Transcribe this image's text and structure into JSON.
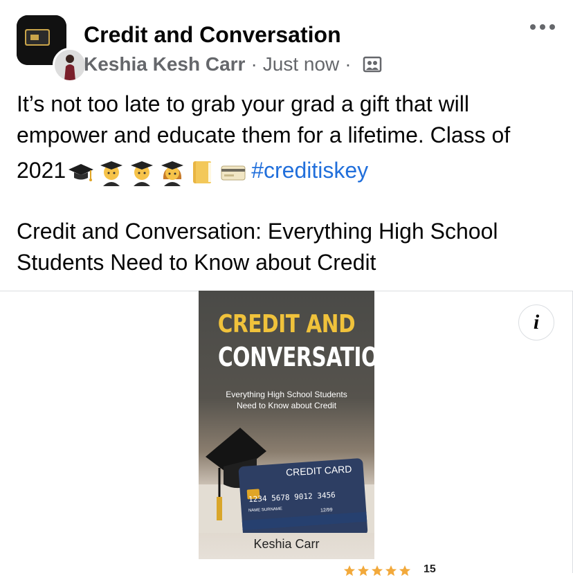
{
  "header": {
    "group_name": "Credit and Conversation",
    "author": "Keshia Kesh Carr",
    "separator": "·",
    "timestamp": "Just now",
    "privacy_icon": "group-privacy-icon",
    "more_icon": "more-options-icon"
  },
  "post": {
    "line1": "It’s not too late to grab your grad a gift that will",
    "line2": "empower and educate them for a lifetime. Class of",
    "line3_prefix": "2021",
    "emojis": [
      "graduation-cap-icon",
      "man-student-icon",
      "man-student-icon",
      "woman-student-icon",
      "ledger-icon",
      "credit-card-icon"
    ],
    "hashtag": "#creditiskey",
    "link_line1": "Credit and Conversation: Everything High School",
    "link_line2": "Students Need to Know about Credit"
  },
  "card": {
    "info_label": "i",
    "book": {
      "title_line1": "CREDIT AND",
      "title_line2": "CONVERSATION",
      "subtitle_line1": "Everything High School Students",
      "subtitle_line2": "Need to Know about Credit",
      "card_label": "CREDIT CARD",
      "card_number": "1234 5678 9012 3456",
      "card_name": "NAME SURNAME",
      "card_expiry": "12/99",
      "author": "Keshia Carr"
    },
    "rating_stars": 5,
    "rating_count": "15"
  },
  "colors": {
    "hashtag": "#216fdb",
    "meta": "#65676b",
    "book_title_accent": "#f0c23b",
    "credit_card": "#2d3e63"
  }
}
